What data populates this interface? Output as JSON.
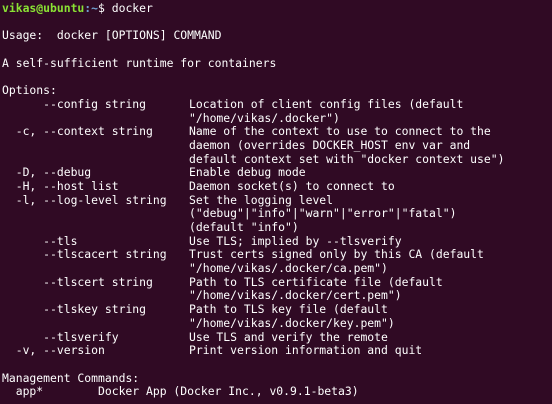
{
  "prompt": {
    "user_host": "vikas@ubuntu",
    "path": ":~",
    "symbol": "$ ",
    "command": "docker"
  },
  "usage": "Usage:  docker [OPTIONS] COMMAND",
  "description": "A self-sufficient runtime for containers",
  "options_header": "Options:",
  "options": [
    {
      "flag": "      --config string",
      "desc": [
        "Location of client config files (default",
        "\"/home/vikas/.docker\")"
      ]
    },
    {
      "flag": "  -c, --context string",
      "desc": [
        "Name of the context to use to connect to the",
        "daemon (overrides DOCKER_HOST env var and",
        "default context set with \"docker context use\")"
      ]
    },
    {
      "flag": "  -D, --debug",
      "desc": [
        "Enable debug mode"
      ]
    },
    {
      "flag": "  -H, --host list",
      "desc": [
        "Daemon socket(s) to connect to"
      ]
    },
    {
      "flag": "  -l, --log-level string",
      "desc": [
        "Set the logging level",
        "(\"debug\"|\"info\"|\"warn\"|\"error\"|\"fatal\")",
        "(default \"info\")"
      ]
    },
    {
      "flag": "      --tls",
      "desc": [
        "Use TLS; implied by --tlsverify"
      ]
    },
    {
      "flag": "      --tlscacert string",
      "desc": [
        "Trust certs signed only by this CA (default",
        "\"/home/vikas/.docker/ca.pem\")"
      ]
    },
    {
      "flag": "      --tlscert string",
      "desc": [
        "Path to TLS certificate file (default",
        "\"/home/vikas/.docker/cert.pem\")"
      ]
    },
    {
      "flag": "      --tlskey string",
      "desc": [
        "Path to TLS key file (default",
        "\"/home/vikas/.docker/key.pem\")"
      ]
    },
    {
      "flag": "      --tlsverify",
      "desc": [
        "Use TLS and verify the remote"
      ]
    },
    {
      "flag": "  -v, --version",
      "desc": [
        "Print version information and quit"
      ]
    }
  ],
  "management_header": "Management Commands:",
  "management_commands": [
    {
      "name": "  app*",
      "desc": "Docker App (Docker Inc., v0.9.1-beta3)"
    }
  ],
  "colors": {
    "background": "#300a24",
    "text": "#ffffff",
    "prompt_user": "#8ae234",
    "prompt_path": "#729fcf"
  }
}
